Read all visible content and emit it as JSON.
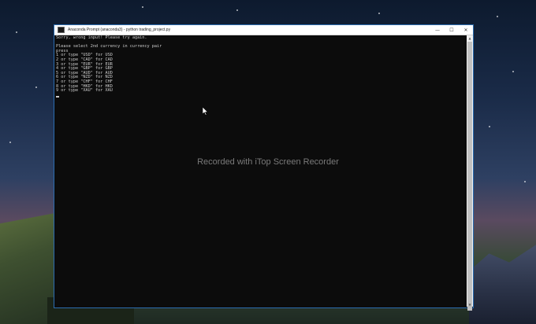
{
  "window": {
    "title": "Anaconda Prompt (anaconda3) - python  trading_project.py",
    "controls": {
      "minimize": "—",
      "maximize": "☐",
      "close": "✕"
    }
  },
  "console": {
    "lines": [
      "Sorry, wrong input! Please try again.",
      "",
      "Please select 2nd currency in currency pair",
      "press",
      "1 or type \"USD\" for USD",
      "2 or type \"CAD\" for CAD",
      "3 or type \"EUR\" for EUR",
      "4 or type \"GBP\" for GBP",
      "5 or type \"AUD\" for AUD",
      "6 or type \"NZD\" for NZD",
      "7 or type \"CHF\" for CHF",
      "8 or type \"HKD\" for HKD",
      "9 or type \"XAU\" for XAU"
    ]
  },
  "watermark": "Recorded with iTop Screen Recorder",
  "icons": {
    "app": "console-app-icon",
    "cursor": "mouse-pointer-icon"
  },
  "colors": {
    "console_bg": "#0c0c0c",
    "console_text": "#cccccc",
    "window_border": "#2b6cb0"
  }
}
